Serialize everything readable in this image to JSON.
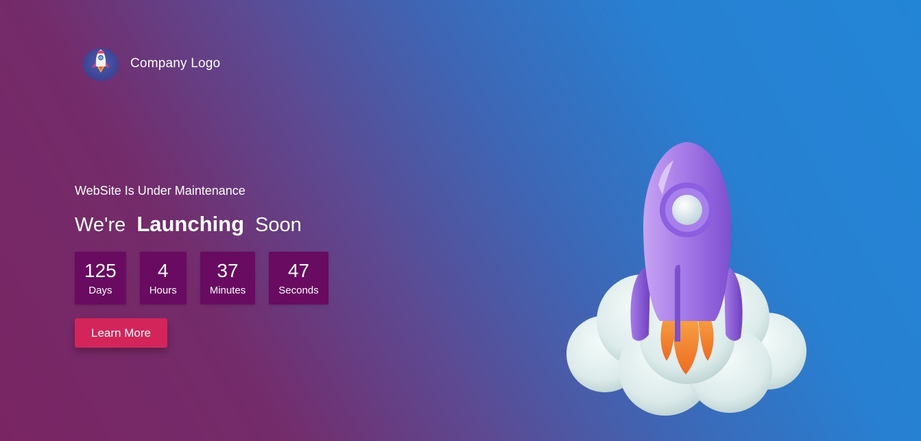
{
  "brand": {
    "logo_icon": "rocket-icon",
    "name": "Company Logo"
  },
  "hero": {
    "subtitle": "WebSite Is Under Maintenance",
    "headline_prefix": "We're",
    "headline_strong": "Launching",
    "headline_suffix": "Soon"
  },
  "countdown": [
    {
      "value": "125",
      "label": "Days"
    },
    {
      "value": "4",
      "label": "Hours"
    },
    {
      "value": "37",
      "label": "Minutes"
    },
    {
      "value": "47",
      "label": "Seconds"
    }
  ],
  "cta": {
    "label": "Learn More"
  },
  "illustration": {
    "icon": "rocket-cloud-illustration",
    "colors": {
      "rocket": "#9b6fe0",
      "flame": "#f37a2c",
      "cloud": "#e4f0ef"
    }
  },
  "colors": {
    "accent": "#d4255b",
    "countdown_box": "#6a0b62"
  }
}
